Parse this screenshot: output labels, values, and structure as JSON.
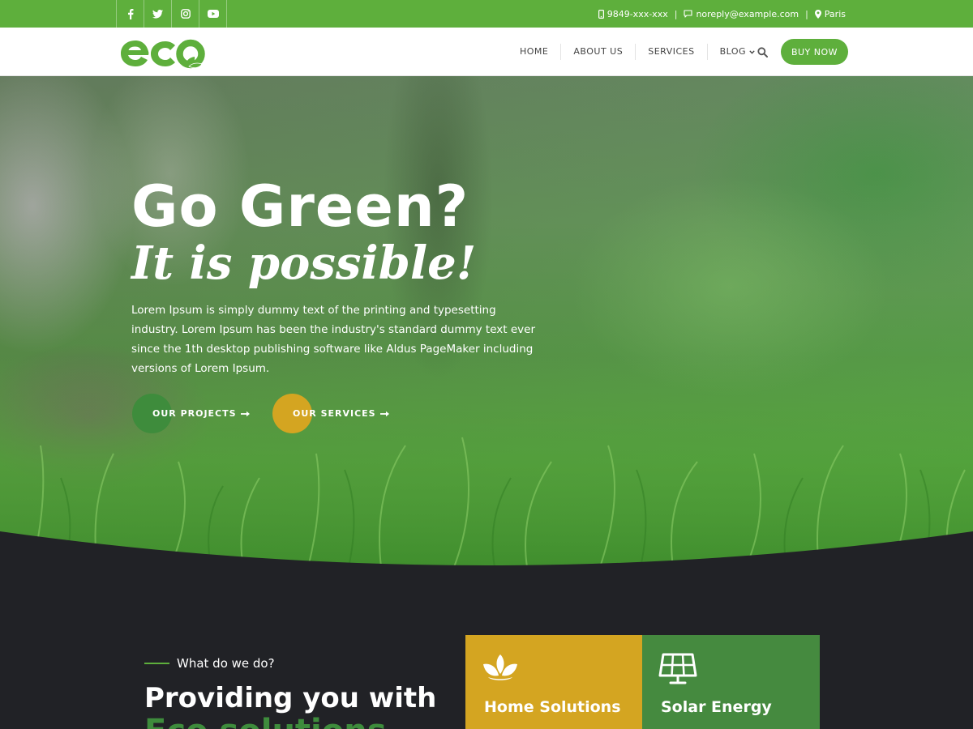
{
  "topbar": {
    "social": [
      {
        "icon": "facebook-icon"
      },
      {
        "icon": "twitter-icon"
      },
      {
        "icon": "instagram-icon"
      },
      {
        "icon": "youtube-icon"
      }
    ],
    "phone": "9849-xxx-xxx",
    "email": "noreply@example.com",
    "location": "Paris",
    "separator": "|"
  },
  "header": {
    "logo_text": "eco",
    "nav": [
      {
        "label": "HOME"
      },
      {
        "label": "ABOUT US"
      },
      {
        "label": "SERVICES"
      },
      {
        "label": "BLOG"
      }
    ],
    "buy_label": "BUY NOW"
  },
  "hero": {
    "title": "Go Green?",
    "subtitle": "It is possible!",
    "text": "Lorem Ipsum is simply dummy text of the printing and typesetting industry. Lorem Ipsum has been the industry's standard dummy text ever since the 1th desktop publishing software like Aldus PageMaker including versions of Lorem Ipsum.",
    "cta_projects": "OUR PROJECTS",
    "cta_services": "OUR SERVICES"
  },
  "section": {
    "eyebrow": "What do we do?",
    "heading": "Providing you with",
    "heading_accent": "Eco solutions",
    "cards": [
      {
        "title": "Home Solutions",
        "icon": "lotus-icon"
      },
      {
        "title": "Solar Energy",
        "icon": "solar-panel-icon"
      }
    ]
  },
  "colors": {
    "brand_green": "#5eaf3c",
    "dark_green": "#3e8c3c",
    "gold": "#d4a521",
    "dark_bg": "#212226"
  }
}
